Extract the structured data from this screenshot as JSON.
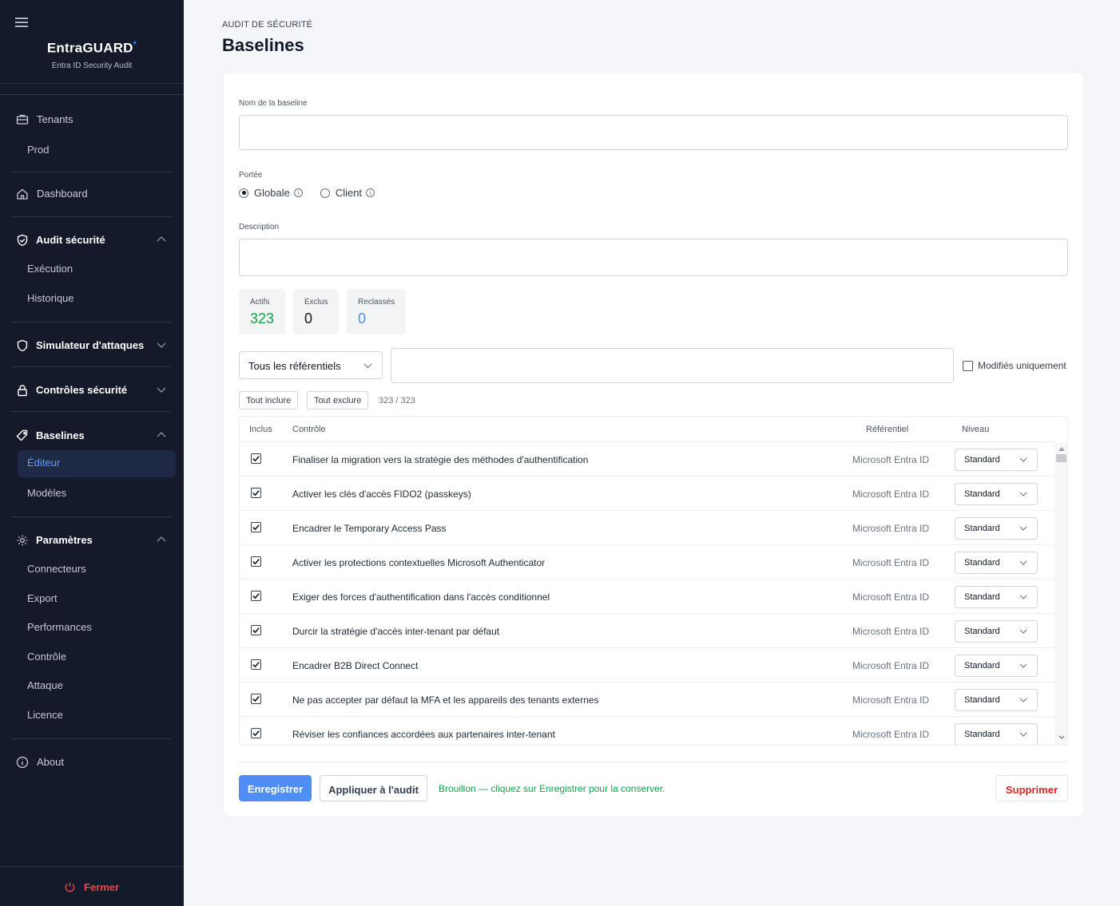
{
  "app": {
    "name": "EntraGUARD",
    "name_mark": "*",
    "subtitle": "Entra ID Security Audit"
  },
  "sidebar": {
    "tenants_label": "Tenants",
    "tenant_current": "Prod",
    "dashboard_label": "Dashboard",
    "audit": {
      "label": "Audit sécurité",
      "items": [
        "Exécution",
        "Historique"
      ]
    },
    "simulator_label": "Simulateur d'attaques",
    "controls_label": "Contrôles sécurité",
    "baselines": {
      "label": "Baselines",
      "active_item": "Éditeur",
      "items": [
        "Modèles"
      ]
    },
    "settings": {
      "label": "Paramètres",
      "items": [
        "Connecteurs",
        "Export",
        "Performances",
        "Contrôle",
        "Attaque",
        "Licence"
      ]
    },
    "about_label": "About",
    "close_label": "Fermer"
  },
  "header": {
    "breadcrumb": "AUDIT DE SÉCURITÉ",
    "title": "Baselines"
  },
  "form": {
    "name_label": "Nom de la baseline",
    "name_value": "",
    "scope_label": "Portée",
    "scope_options": [
      "Globale",
      "Client"
    ],
    "scope_selected": "Globale",
    "description_label": "Description",
    "description_value": ""
  },
  "stats": {
    "active": {
      "label": "Actifs",
      "value": "323"
    },
    "excluded": {
      "label": "Exclus",
      "value": "0"
    },
    "reclassified": {
      "label": "Reclassés",
      "value": "0"
    }
  },
  "filters": {
    "framework_selected": "Tous les référentiels",
    "search_value": "",
    "modified_only_label": "Modifiés uniquement",
    "modified_only_checked": false,
    "include_all_label": "Tout inclure",
    "exclude_all_label": "Tout exclure",
    "count_text": "323 / 323"
  },
  "table": {
    "headers": {
      "included": "Inclus",
      "control": "Contrôle",
      "framework": "Référentiel",
      "level": "Niveau"
    },
    "rows": [
      {
        "included": true,
        "control": "Finaliser la migration vers la stratégie des méthodes d'authentification",
        "framework": "Microsoft Entra ID",
        "level": "Standard"
      },
      {
        "included": true,
        "control": "Activer les clés d'accès FIDO2 (passkeys)",
        "framework": "Microsoft Entra ID",
        "level": "Standard"
      },
      {
        "included": true,
        "control": "Encadrer le Temporary Access Pass",
        "framework": "Microsoft Entra ID",
        "level": "Standard"
      },
      {
        "included": true,
        "control": "Activer les protections contextuelles Microsoft Authenticator",
        "framework": "Microsoft Entra ID",
        "level": "Standard"
      },
      {
        "included": true,
        "control": "Exiger des forces d'authentification dans l'accès conditionnel",
        "framework": "Microsoft Entra ID",
        "level": "Standard"
      },
      {
        "included": true,
        "control": "Durcir la stratégie d'accès inter-tenant par défaut",
        "framework": "Microsoft Entra ID",
        "level": "Standard"
      },
      {
        "included": true,
        "control": "Encadrer B2B Direct Connect",
        "framework": "Microsoft Entra ID",
        "level": "Standard"
      },
      {
        "included": true,
        "control": "Ne pas accepter par défaut la MFA et les appareils des tenants externes",
        "framework": "Microsoft Entra ID",
        "level": "Standard"
      },
      {
        "included": true,
        "control": "Réviser les confiances accordées aux partenaires inter-tenant",
        "framework": "Microsoft Entra ID",
        "level": "Standard"
      }
    ]
  },
  "actions": {
    "save_label": "Enregistrer",
    "apply_label": "Appliquer à l'audit",
    "draft_message": "Brouillon — cliquez sur Enregistrer pour la conserver.",
    "delete_label": "Supprimer"
  },
  "colors": {
    "sidebar_bg": "#141a2a",
    "accent_blue": "#4f8ef7",
    "active_green": "#16a34a",
    "danger_red": "#dc2626"
  }
}
